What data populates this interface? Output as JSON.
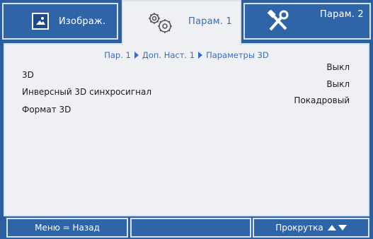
{
  "tabs": [
    {
      "label": "Изображ.",
      "icon": "image-icon"
    },
    {
      "label": "Парам. 1",
      "icon": "gears-icon"
    },
    {
      "label": "Парам. 2",
      "icon": "tools-icon"
    }
  ],
  "breadcrumb": [
    "Пар. 1",
    "Доп. Наст. 1",
    "Параметры 3D"
  ],
  "settings": [
    {
      "label": "3D",
      "value": "Выкл"
    },
    {
      "label": "Инверсный 3D синхросигнал",
      "value": "Выкл"
    },
    {
      "label": "Формат 3D",
      "value": "Покадровый"
    }
  ],
  "footer": {
    "menu_back": "Меню = Назад",
    "scroll": "Прокрутка"
  },
  "colors": {
    "tab_blue": "#2f64a6",
    "accent_text": "#3d6db4",
    "panel_bg": "#eef0f3"
  }
}
